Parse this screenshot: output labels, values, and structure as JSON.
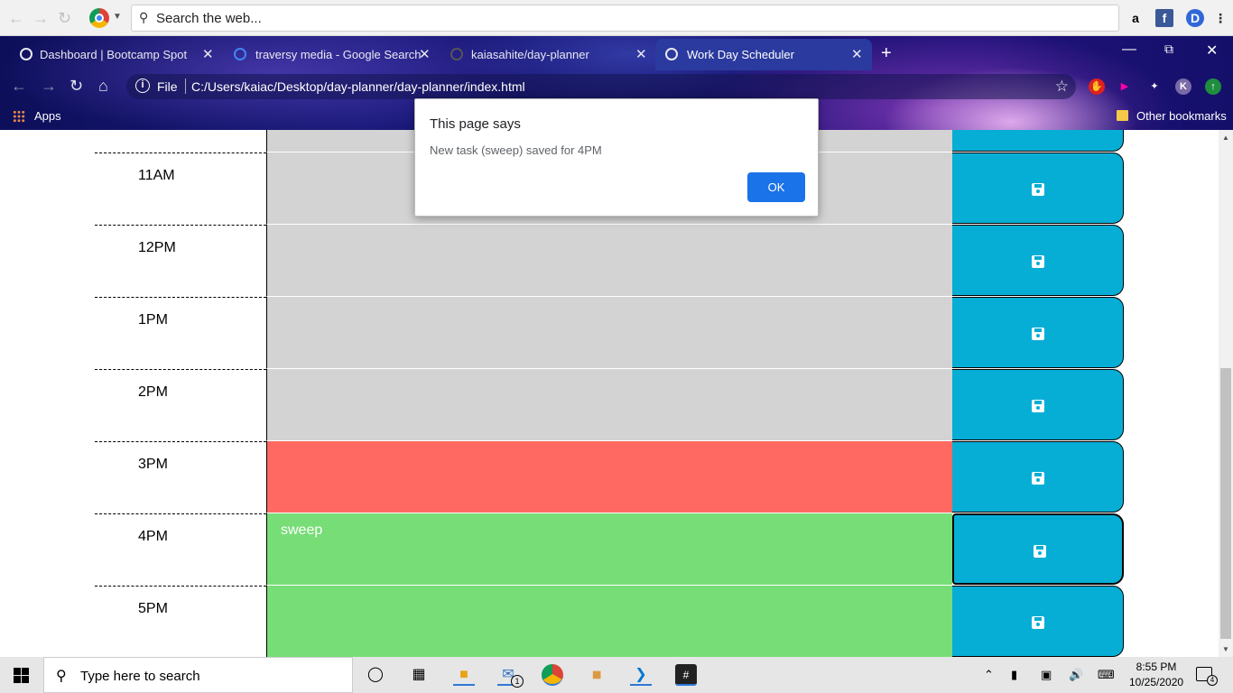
{
  "search_bar": {
    "placeholder": "Search the web..."
  },
  "tabs": [
    {
      "title": "Dashboard | Bootcamp Spot",
      "active": false
    },
    {
      "title": "traversy media - Google Search",
      "active": false
    },
    {
      "title": "kaiasahite/day-planner",
      "active": false
    },
    {
      "title": "Work Day Scheduler",
      "active": true
    }
  ],
  "address_bar": {
    "scheme": "File",
    "url": "C:/Users/kaiac/Desktop/day-planner/day-planner/index.html"
  },
  "bookmarks": {
    "apps": "Apps",
    "other": "Other bookmarks"
  },
  "profile_initial": "K",
  "planner": {
    "rows": [
      {
        "hour": "",
        "task": "",
        "state": "past"
      },
      {
        "hour": "11AM",
        "task": "",
        "state": "past"
      },
      {
        "hour": "12PM",
        "task": "",
        "state": "past"
      },
      {
        "hour": "1PM",
        "task": "",
        "state": "past"
      },
      {
        "hour": "2PM",
        "task": "",
        "state": "past"
      },
      {
        "hour": "3PM",
        "task": "",
        "state": "present"
      },
      {
        "hour": "4PM",
        "task": "sweep",
        "state": "future"
      },
      {
        "hour": "5PM",
        "task": "",
        "state": "future"
      }
    ],
    "colors": {
      "past": "#d3d3d3",
      "present": "#ff6961",
      "future": "#77dd77",
      "save": "#06aed5"
    }
  },
  "alert": {
    "title": "This page says",
    "message": "New task (sweep) saved for 4PM",
    "ok_label": "OK"
  },
  "taskbar": {
    "search_placeholder": "Type here to search",
    "time": "8:55 PM",
    "date": "10/25/2020",
    "mail_badge": "1",
    "notification_count": "4"
  }
}
